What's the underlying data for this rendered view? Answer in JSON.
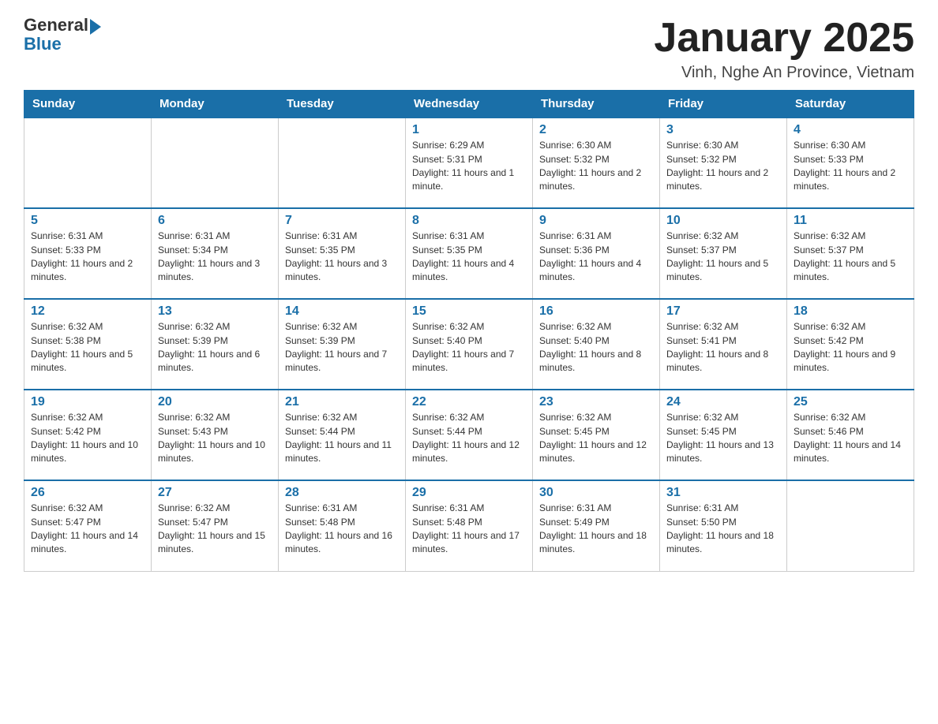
{
  "header": {
    "logo_general": "General",
    "logo_blue": "Blue",
    "title": "January 2025",
    "subtitle": "Vinh, Nghe An Province, Vietnam"
  },
  "days": [
    "Sunday",
    "Monday",
    "Tuesday",
    "Wednesday",
    "Thursday",
    "Friday",
    "Saturday"
  ],
  "weeks": [
    [
      {
        "day": "",
        "info": ""
      },
      {
        "day": "",
        "info": ""
      },
      {
        "day": "",
        "info": ""
      },
      {
        "day": "1",
        "info": "Sunrise: 6:29 AM\nSunset: 5:31 PM\nDaylight: 11 hours and 1 minute."
      },
      {
        "day": "2",
        "info": "Sunrise: 6:30 AM\nSunset: 5:32 PM\nDaylight: 11 hours and 2 minutes."
      },
      {
        "day": "3",
        "info": "Sunrise: 6:30 AM\nSunset: 5:32 PM\nDaylight: 11 hours and 2 minutes."
      },
      {
        "day": "4",
        "info": "Sunrise: 6:30 AM\nSunset: 5:33 PM\nDaylight: 11 hours and 2 minutes."
      }
    ],
    [
      {
        "day": "5",
        "info": "Sunrise: 6:31 AM\nSunset: 5:33 PM\nDaylight: 11 hours and 2 minutes."
      },
      {
        "day": "6",
        "info": "Sunrise: 6:31 AM\nSunset: 5:34 PM\nDaylight: 11 hours and 3 minutes."
      },
      {
        "day": "7",
        "info": "Sunrise: 6:31 AM\nSunset: 5:35 PM\nDaylight: 11 hours and 3 minutes."
      },
      {
        "day": "8",
        "info": "Sunrise: 6:31 AM\nSunset: 5:35 PM\nDaylight: 11 hours and 4 minutes."
      },
      {
        "day": "9",
        "info": "Sunrise: 6:31 AM\nSunset: 5:36 PM\nDaylight: 11 hours and 4 minutes."
      },
      {
        "day": "10",
        "info": "Sunrise: 6:32 AM\nSunset: 5:37 PM\nDaylight: 11 hours and 5 minutes."
      },
      {
        "day": "11",
        "info": "Sunrise: 6:32 AM\nSunset: 5:37 PM\nDaylight: 11 hours and 5 minutes."
      }
    ],
    [
      {
        "day": "12",
        "info": "Sunrise: 6:32 AM\nSunset: 5:38 PM\nDaylight: 11 hours and 5 minutes."
      },
      {
        "day": "13",
        "info": "Sunrise: 6:32 AM\nSunset: 5:39 PM\nDaylight: 11 hours and 6 minutes."
      },
      {
        "day": "14",
        "info": "Sunrise: 6:32 AM\nSunset: 5:39 PM\nDaylight: 11 hours and 7 minutes."
      },
      {
        "day": "15",
        "info": "Sunrise: 6:32 AM\nSunset: 5:40 PM\nDaylight: 11 hours and 7 minutes."
      },
      {
        "day": "16",
        "info": "Sunrise: 6:32 AM\nSunset: 5:40 PM\nDaylight: 11 hours and 8 minutes."
      },
      {
        "day": "17",
        "info": "Sunrise: 6:32 AM\nSunset: 5:41 PM\nDaylight: 11 hours and 8 minutes."
      },
      {
        "day": "18",
        "info": "Sunrise: 6:32 AM\nSunset: 5:42 PM\nDaylight: 11 hours and 9 minutes."
      }
    ],
    [
      {
        "day": "19",
        "info": "Sunrise: 6:32 AM\nSunset: 5:42 PM\nDaylight: 11 hours and 10 minutes."
      },
      {
        "day": "20",
        "info": "Sunrise: 6:32 AM\nSunset: 5:43 PM\nDaylight: 11 hours and 10 minutes."
      },
      {
        "day": "21",
        "info": "Sunrise: 6:32 AM\nSunset: 5:44 PM\nDaylight: 11 hours and 11 minutes."
      },
      {
        "day": "22",
        "info": "Sunrise: 6:32 AM\nSunset: 5:44 PM\nDaylight: 11 hours and 12 minutes."
      },
      {
        "day": "23",
        "info": "Sunrise: 6:32 AM\nSunset: 5:45 PM\nDaylight: 11 hours and 12 minutes."
      },
      {
        "day": "24",
        "info": "Sunrise: 6:32 AM\nSunset: 5:45 PM\nDaylight: 11 hours and 13 minutes."
      },
      {
        "day": "25",
        "info": "Sunrise: 6:32 AM\nSunset: 5:46 PM\nDaylight: 11 hours and 14 minutes."
      }
    ],
    [
      {
        "day": "26",
        "info": "Sunrise: 6:32 AM\nSunset: 5:47 PM\nDaylight: 11 hours and 14 minutes."
      },
      {
        "day": "27",
        "info": "Sunrise: 6:32 AM\nSunset: 5:47 PM\nDaylight: 11 hours and 15 minutes."
      },
      {
        "day": "28",
        "info": "Sunrise: 6:31 AM\nSunset: 5:48 PM\nDaylight: 11 hours and 16 minutes."
      },
      {
        "day": "29",
        "info": "Sunrise: 6:31 AM\nSunset: 5:48 PM\nDaylight: 11 hours and 17 minutes."
      },
      {
        "day": "30",
        "info": "Sunrise: 6:31 AM\nSunset: 5:49 PM\nDaylight: 11 hours and 18 minutes."
      },
      {
        "day": "31",
        "info": "Sunrise: 6:31 AM\nSunset: 5:50 PM\nDaylight: 11 hours and 18 minutes."
      },
      {
        "day": "",
        "info": ""
      }
    ]
  ]
}
